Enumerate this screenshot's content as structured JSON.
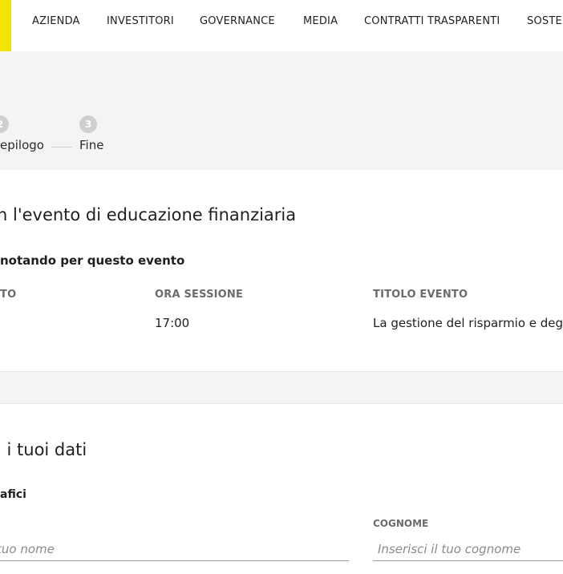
{
  "nav": {
    "items": [
      {
        "label": "AZIENDA"
      },
      {
        "label": "INVESTITORI"
      },
      {
        "label": "GOVERNANCE"
      },
      {
        "label": "MEDIA"
      },
      {
        "label": "CONTRATTI TRASPARENTI"
      },
      {
        "label": "SOSTE"
      }
    ],
    "brand_color": "#f2e400"
  },
  "stepper": {
    "steps": [
      {
        "number": "2",
        "label": "epilogo"
      },
      {
        "number": "3",
        "label": "Fine"
      }
    ]
  },
  "event": {
    "title": "n l'evento di educazione finanziaria",
    "subtitle": "notando per questo evento",
    "columns": [
      {
        "header": "TO",
        "value": ""
      },
      {
        "header": "ORA SESSIONE",
        "value": "17:00"
      },
      {
        "header": "TITOLO EVENTO",
        "value": "La gestione del risparmio e degli"
      }
    ]
  },
  "personal": {
    "title": "i i tuoi dati",
    "subtitle": "afici",
    "fields": {
      "nome": {
        "label": "",
        "placeholder": "tuo nome"
      },
      "cognome": {
        "label": "COGNOME",
        "placeholder": "Inserisci il tuo cognome"
      }
    }
  }
}
